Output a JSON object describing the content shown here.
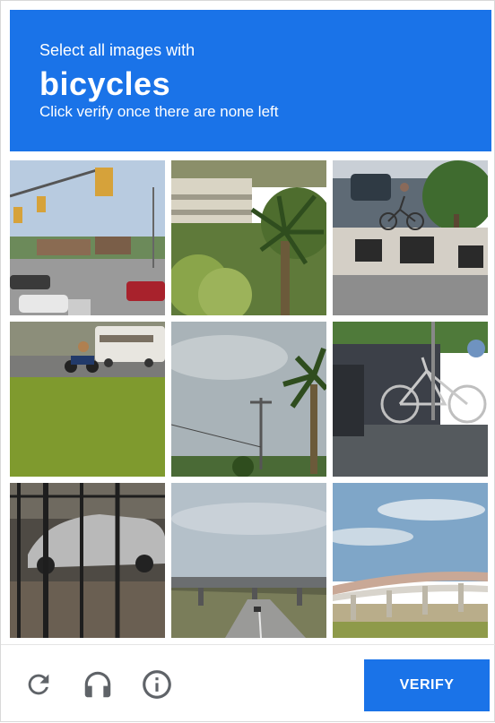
{
  "header": {
    "line1": "Select all images with",
    "target": "bicycles",
    "line3": "Click verify once there are none left"
  },
  "tiles": [
    {
      "id": 1,
      "scene": "intersection with traffic lights and parked cars"
    },
    {
      "id": 2,
      "scene": "palm shrub in front of building"
    },
    {
      "id": 3,
      "scene": "cyclist on sidewalk near planters"
    },
    {
      "id": 4,
      "scene": "motorcycle on road by grass field"
    },
    {
      "id": 5,
      "scene": "palm tree and utility pole under cloudy sky"
    },
    {
      "id": 6,
      "scene": "bicycles parked along sidewalk"
    },
    {
      "id": 7,
      "scene": "car behind window reflection"
    },
    {
      "id": 8,
      "scene": "highway overpass"
    },
    {
      "id": 9,
      "scene": "elevated roadway bridge"
    }
  ],
  "footer": {
    "reload_icon": "reload-icon",
    "audio_icon": "headphones-icon",
    "info_icon": "info-icon",
    "verify_label": "VERIFY"
  },
  "colors": {
    "accent": "#1a73e8",
    "icon": "#5f6368"
  }
}
